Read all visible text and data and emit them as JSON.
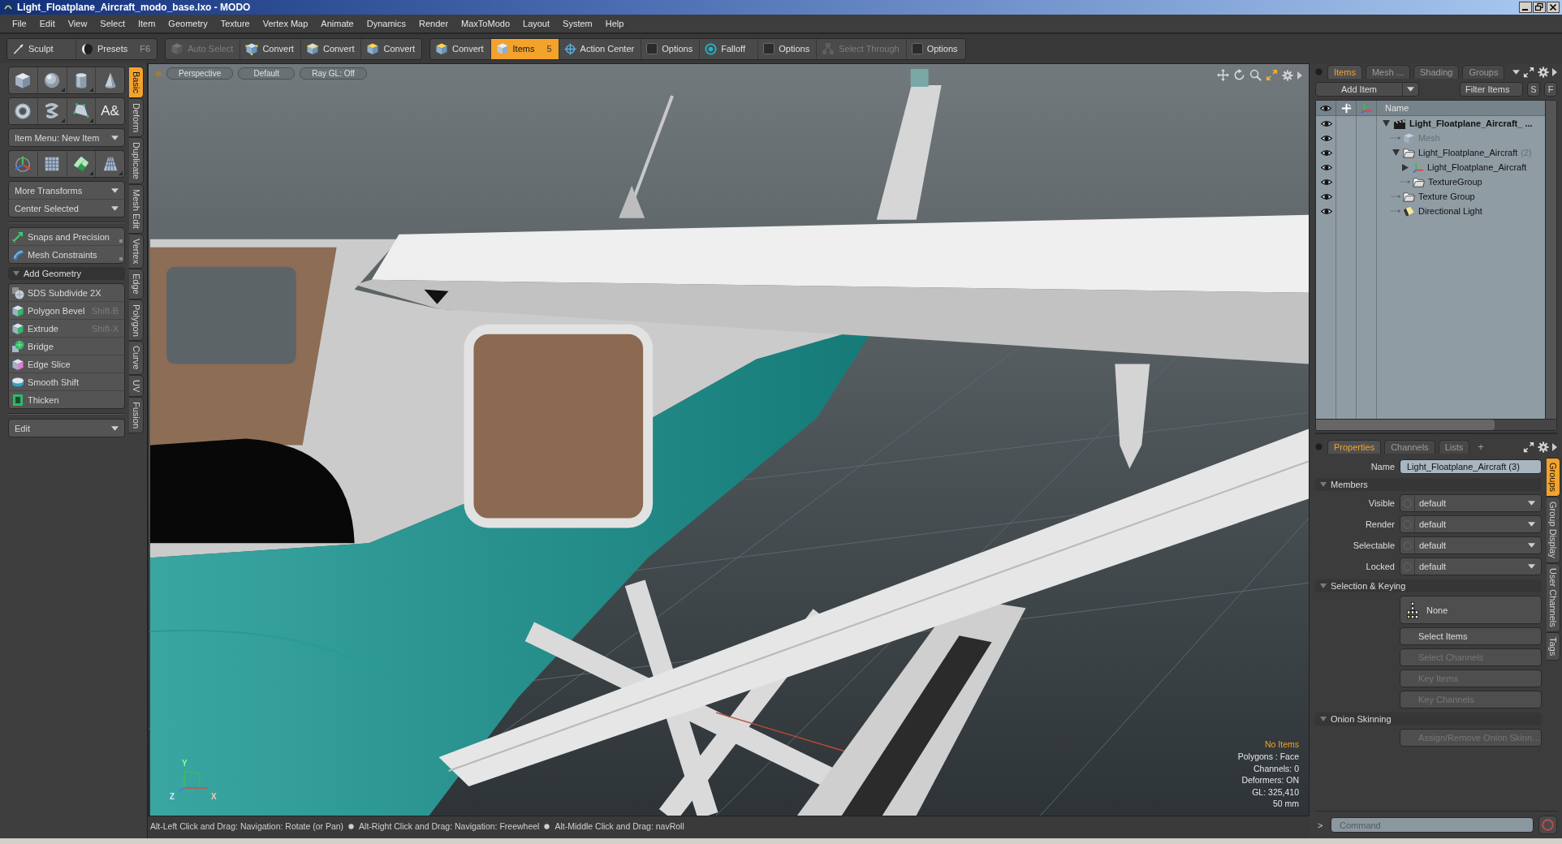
{
  "window": {
    "title": "Light_Floatplane_Aircraft_modo_base.lxo - MODO"
  },
  "menu": [
    "File",
    "Edit",
    "View",
    "Select",
    "Item",
    "Geometry",
    "Texture",
    "Vertex Map",
    "Animate",
    "Dynamics",
    "Render",
    "MaxToModo",
    "Layout",
    "System",
    "Help"
  ],
  "toolbar": [
    [
      {
        "kind": "button",
        "label": "Sculpt",
        "selected": false,
        "disabled": false
      },
      {
        "kind": "button",
        "label": "Presets",
        "shortcut": "F6",
        "selected": false,
        "disabled": false
      }
    ],
    [
      {
        "kind": "button",
        "label": "Auto Select",
        "selected": false,
        "disabled": true
      },
      {
        "kind": "button",
        "label": "Convert",
        "selected": false,
        "disabled": false
      },
      {
        "kind": "button",
        "label": "Convert",
        "selected": false,
        "disabled": false
      },
      {
        "kind": "button",
        "label": "Convert",
        "selected": false,
        "disabled": false
      }
    ],
    [
      {
        "kind": "button",
        "label": "Convert",
        "selected": false,
        "disabled": false
      },
      {
        "kind": "button",
        "label": "Items",
        "badge": "5",
        "selected": true,
        "disabled": false
      },
      {
        "kind": "button",
        "label": "Action Center",
        "selected": false,
        "disabled": false
      },
      {
        "kind": "checkbox",
        "label": "Options",
        "checked": false
      },
      {
        "kind": "button",
        "label": "Falloff",
        "selected": false,
        "disabled": false
      },
      {
        "kind": "checkbox",
        "label": "Options",
        "checked": false
      },
      {
        "kind": "button",
        "label": "Select Through",
        "selected": false,
        "disabled": true
      },
      {
        "kind": "checkbox",
        "label": "Options",
        "checked": false
      }
    ]
  ],
  "tool_palette": {
    "blocks": [
      {
        "kind": "icons",
        "buttons": [
          {
            "submenu": false
          },
          {
            "submenu": true
          },
          {
            "submenu": true
          },
          {
            "submenu": false
          }
        ]
      },
      {
        "kind": "icons",
        "buttons": [
          {
            "submenu": false
          },
          {
            "submenu": true
          },
          {
            "submenu": true
          },
          {
            "submenu": false,
            "glyph": "A&"
          }
        ]
      },
      {
        "kind": "menu",
        "entries": [
          {
            "label": "Item Menu: New Item"
          }
        ]
      },
      {
        "kind": "icons",
        "buttons": [
          {
            "submenu": false
          },
          {
            "submenu": false
          },
          {
            "submenu": true
          },
          {
            "submenu": true
          }
        ]
      },
      {
        "kind": "menu",
        "entries": [
          {
            "label": "More Transforms"
          },
          {
            "label": "Center Selected"
          }
        ]
      },
      {
        "kind": "divider"
      },
      {
        "kind": "tools",
        "entries": [
          {
            "label": "Snaps and Precision",
            "popover": true
          },
          {
            "label": "Mesh Constraints",
            "popover": true
          }
        ]
      },
      {
        "kind": "section",
        "label": "Add Geometry",
        "expanded": true,
        "entries": [
          {
            "label": "SDS Subdivide 2X"
          },
          {
            "label": "Polygon Bevel",
            "shortcut": "Shift-B"
          },
          {
            "label": "Extrude",
            "shortcut": "Shift-X"
          },
          {
            "label": "Bridge"
          },
          {
            "label": "Edge Slice"
          },
          {
            "label": "Smooth Shift"
          },
          {
            "label": "Thicken"
          }
        ]
      },
      {
        "kind": "divider"
      },
      {
        "kind": "menu",
        "entries": [
          {
            "label": "Edit"
          }
        ]
      }
    ],
    "tabs": [
      {
        "label": "Basic",
        "selected": true
      },
      {
        "label": "Deform",
        "selected": false
      },
      {
        "label": "Duplicate",
        "selected": false
      },
      {
        "label": "Mesh Edit",
        "selected": false
      },
      {
        "label": "Vertex",
        "selected": false
      },
      {
        "label": "Edge",
        "selected": false
      },
      {
        "label": "Polygon",
        "selected": false
      },
      {
        "label": "Curve",
        "selected": false
      },
      {
        "label": "UV",
        "selected": false
      },
      {
        "label": "Fusion",
        "selected": false
      }
    ]
  },
  "viewport": {
    "header": [
      "Perspective",
      "Default",
      "Ray GL: Off"
    ],
    "axis_labels": [
      "Y",
      "Z",
      "X"
    ],
    "info": [
      {
        "text": "No Items",
        "highlighted": true
      },
      {
        "text": "Polygons : Face",
        "highlighted": false
      },
      {
        "text": "Channels: 0",
        "highlighted": false
      },
      {
        "text": "Deformers: ON",
        "highlighted": false
      },
      {
        "text": "GL: 325,410",
        "highlighted": false
      },
      {
        "text": "50 mm",
        "highlighted": false
      }
    ]
  },
  "status_bar": {
    "hints": [
      "Alt-Left Click and Drag: Navigation: Rotate (or Pan)",
      "Alt-Right Click and Drag: Navigation: Freewheel",
      "Alt-Middle Click and Drag: navRoll"
    ]
  },
  "items_panel": {
    "tabs": [
      {
        "label": "Items",
        "selected": true
      },
      {
        "label": "Mesh ...",
        "selected": false
      },
      {
        "label": "Shading",
        "selected": false
      },
      {
        "label": "Groups",
        "selected": false
      }
    ],
    "add_button": "Add Item",
    "filter_placeholder": "Filter Items",
    "toggles": [
      "S",
      "F"
    ],
    "name_column": "Name",
    "tree": [
      {
        "label": "Light_Floatplane_Aircraft_ ...",
        "kind": "scene",
        "visible": true,
        "disabled": false,
        "selected": false,
        "expanded": true,
        "children": [
          {
            "label": "Mesh",
            "kind": "mesh",
            "visible": true,
            "disabled": true,
            "selected": false
          },
          {
            "label": "Light_Floatplane_Aircraft",
            "count": "(2)",
            "kind": "group",
            "visible": true,
            "disabled": false,
            "selected": false,
            "expanded": true,
            "children": [
              {
                "label": "Light_Floatplane_Aircraft",
                "kind": "locator",
                "visible": true,
                "disabled": false,
                "selected": false,
                "expanded": false
              },
              {
                "label": "TextureGroup",
                "kind": "group",
                "visible": true,
                "disabled": false,
                "selected": false
              }
            ]
          },
          {
            "label": "Texture Group",
            "kind": "group",
            "visible": true,
            "disabled": false,
            "selected": false
          },
          {
            "label": "Directional Light",
            "kind": "light",
            "visible": true,
            "disabled": false,
            "selected": false
          }
        ]
      }
    ]
  },
  "properties_panel": {
    "tabs": [
      {
        "label": "Properties",
        "selected": true
      },
      {
        "label": "Channels",
        "selected": false
      },
      {
        "label": "Lists",
        "selected": false
      }
    ],
    "add_tab": "+",
    "name": {
      "label": "Name",
      "value": "Light_Floatplane_Aircraft (3)"
    },
    "sections": [
      {
        "title": "Members",
        "expanded": true,
        "rows": [
          {
            "kind": "dropdown",
            "label": "Visible",
            "value": "default"
          },
          {
            "kind": "dropdown",
            "label": "Render",
            "value": "default"
          },
          {
            "kind": "dropdown",
            "label": "Selectable",
            "value": "default"
          },
          {
            "kind": "dropdown",
            "label": "Locked",
            "value": "default"
          }
        ]
      },
      {
        "title": "Selection & Keying",
        "expanded": true,
        "rows": [
          {
            "kind": "icon_button",
            "label": "None",
            "disabled": false
          },
          {
            "kind": "button",
            "label": "Select Items",
            "disabled": false
          },
          {
            "kind": "button",
            "label": "Select Channels",
            "disabled": true
          },
          {
            "kind": "button",
            "label": "Key Items",
            "disabled": true
          },
          {
            "kind": "button",
            "label": "Key Channels",
            "disabled": true
          }
        ]
      },
      {
        "title": "Onion Skinning",
        "expanded": true,
        "rows": [
          {
            "kind": "button",
            "label": "Assign/Remove Onion Skinn…",
            "disabled": true
          }
        ]
      }
    ],
    "side_tabs": [
      {
        "label": "Groups",
        "selected": true
      },
      {
        "label": "Group Display",
        "selected": false
      },
      {
        "label": "User Channels",
        "selected": false
      },
      {
        "label": "Tags",
        "selected": false
      }
    ]
  },
  "command_bar": {
    "prompt": ">",
    "placeholder": "Command"
  }
}
